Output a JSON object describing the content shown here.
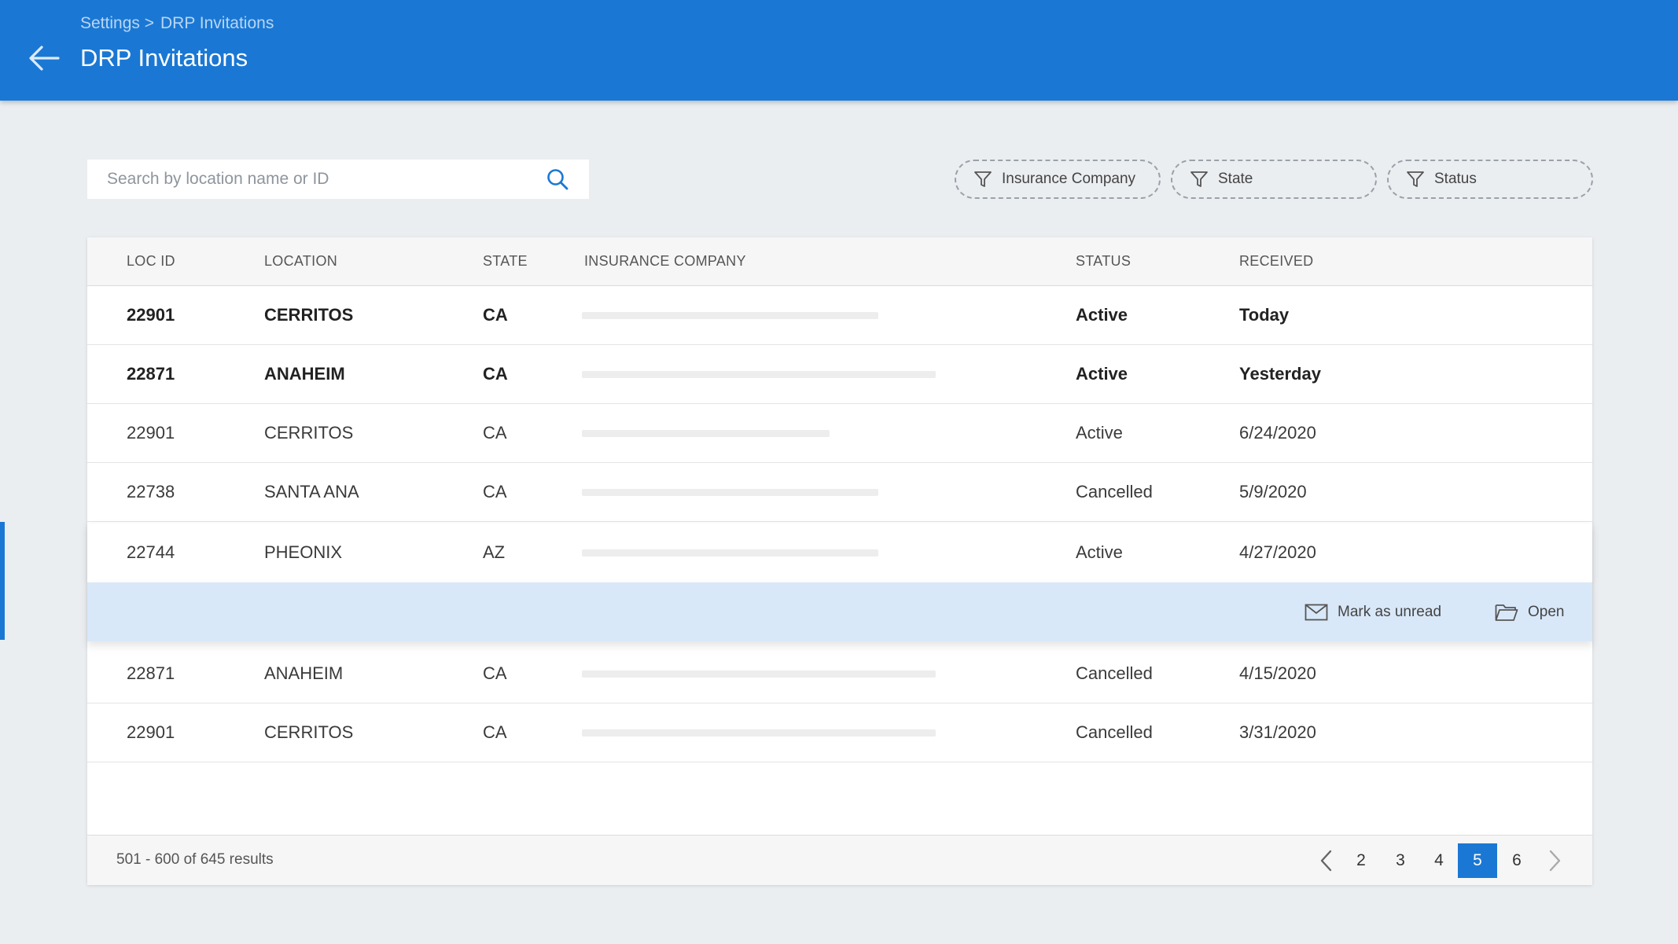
{
  "header": {
    "breadcrumb": [
      "Settings >",
      "DRP Invitations"
    ],
    "title": "DRP Invitations",
    "color": "#1a78d4"
  },
  "search": {
    "placeholder": "Search by location name or ID",
    "value": ""
  },
  "filters": [
    {
      "label": "Insurance Company",
      "icon": "filter-icon"
    },
    {
      "label": "State",
      "icon": "filter-icon"
    },
    {
      "label": "Status",
      "icon": "filter-icon"
    }
  ],
  "table": {
    "columns": [
      "LOC ID",
      "LOCATION",
      "STATE",
      "INSURANCE COMPANY",
      "STATUS",
      "RECEIVED"
    ],
    "rows": [
      {
        "loc_id": "22901",
        "location": "CERRITOS",
        "state": "CA",
        "status": "Active",
        "received": "Today",
        "unread": true
      },
      {
        "loc_id": "22871",
        "location": "ANAHEIM",
        "state": "CA",
        "status": "Active",
        "received": "Yesterday",
        "unread": true
      },
      {
        "loc_id": "22901",
        "location": "CERRITOS",
        "state": "CA",
        "status": "Active",
        "received": "6/24/2020",
        "unread": false
      },
      {
        "loc_id": "22738",
        "location": "SANTA ANA",
        "state": "CA",
        "status": "Cancelled",
        "received": "5/9/2020",
        "unread": false
      },
      {
        "loc_id": "22744",
        "location": "PHEONIX",
        "state": "AZ",
        "status": "Active",
        "received": "4/27/2020",
        "unread": false,
        "selected": true
      },
      {
        "loc_id": "22871",
        "location": "ANAHEIM",
        "state": "CA",
        "status": "Cancelled",
        "received": "4/15/2020",
        "unread": false
      },
      {
        "loc_id": "22901",
        "location": "CERRITOS",
        "state": "CA",
        "status": "Cancelled",
        "received": "3/31/2020",
        "unread": false
      }
    ]
  },
  "row_actions": {
    "mark_unread": "Mark as unread",
    "open": "Open"
  },
  "pagination": {
    "summary": "501 - 600 of 645 results",
    "pages": [
      "2",
      "3",
      "4",
      "5",
      "6"
    ],
    "current": "5"
  }
}
